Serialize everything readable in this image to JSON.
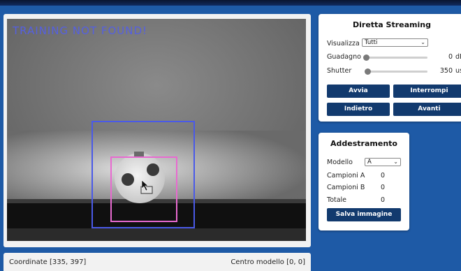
{
  "overlay": {
    "training_status": "TRAINING NOT FOUND!"
  },
  "status_bar": {
    "coords_label": "Coordinate [335, 397]",
    "model_center_label": "Centro modello [0, 0]"
  },
  "stream_panel": {
    "title": "Diretta Streaming",
    "view_label": "Visualizza",
    "view_value": "Tutti",
    "gain_label": "Guadagno",
    "gain_value": "0",
    "gain_unit": "dB",
    "gain_level": 0,
    "shutter_label": "Shutter",
    "shutter_value": "350",
    "shutter_unit": "us",
    "shutter_level": 0.02,
    "buttons": {
      "start": "Avvia",
      "stop": "Interrompi",
      "back": "Indietro",
      "forward": "Avanti"
    }
  },
  "training_panel": {
    "title": "Addestramento",
    "model_label": "Modello",
    "model_value": "A",
    "samples_a_label": "Campioni A",
    "samples_a_value": "0",
    "samples_b_label": "Campioni B",
    "samples_b_value": "0",
    "total_label": "Totale",
    "total_value": "0",
    "save_button": "Salva immagine"
  },
  "colors": {
    "background": "#1e5aa6",
    "button": "#123a6e",
    "detection_box": "#4a5ae8",
    "model_box": "#e86ad0",
    "overlay_text": "#5560e0"
  },
  "icons": {
    "cursor": "mouse-pointer-icon"
  }
}
